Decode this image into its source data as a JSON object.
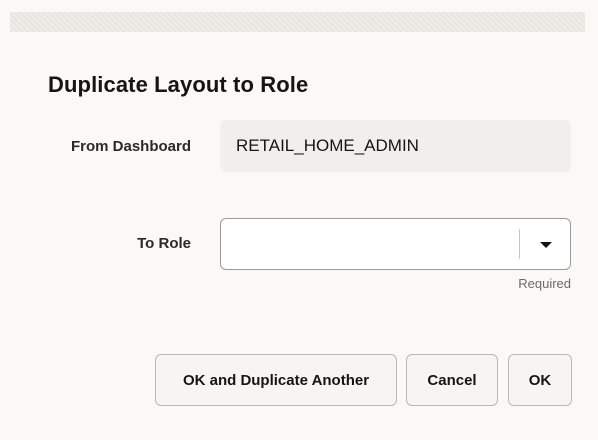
{
  "dialog": {
    "title": "Duplicate Layout to Role"
  },
  "form": {
    "from_dashboard": {
      "label": "From Dashboard",
      "value": "RETAIL_HOME_ADMIN"
    },
    "to_role": {
      "label": "To Role",
      "value": "",
      "helper": "Required",
      "icon": "chevron-down-icon"
    }
  },
  "buttons": {
    "ok_and_duplicate": "OK and Duplicate Another",
    "cancel": "Cancel",
    "ok": "OK"
  }
}
